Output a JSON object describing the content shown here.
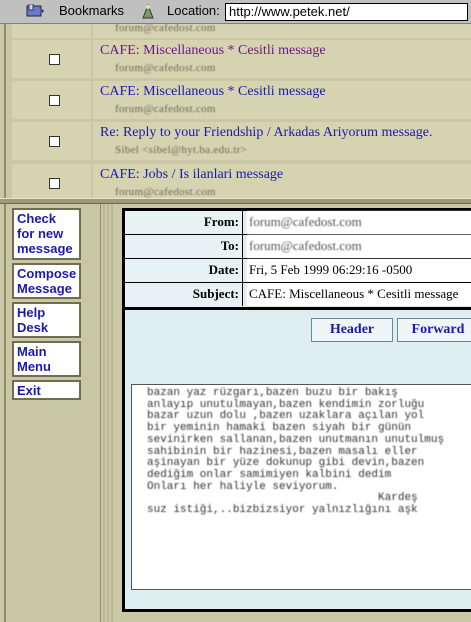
{
  "browser": {
    "bookmarks_label": "Bookmarks",
    "location_label": "Location:",
    "url": "http://www.petek.net/"
  },
  "message_list": [
    {
      "subject": "",
      "from": "forum@cafedost.com"
    },
    {
      "subject": "CAFE: Miscellaneous * Cesitli message",
      "from": "forum@cafedost.com"
    },
    {
      "subject": "CAFE: Miscellaneous * Cesitli message",
      "from": "forum@cafedost.com"
    },
    {
      "subject": "Re: Reply to your Friendship / Arkadas Ariyorum message.",
      "from": "Sibel <sibel@hyt.ba.edu.tr>"
    },
    {
      "subject": "CAFE: Jobs / Is ilanlari message",
      "from": "forum@cafedost.com"
    }
  ],
  "nav": {
    "check": "Check for new message",
    "compose": "Compose Message",
    "help": "Help Desk",
    "main": "Main Menu",
    "exit": "Exit"
  },
  "message": {
    "from_label": "From:",
    "from": "forum@cafedost.com",
    "to_label": "To:",
    "to": "forum@cafedost.com",
    "date_label": "Date:",
    "date": "Fri, 5 Feb 1999 06:29:16 -0500",
    "subject_label": "Subject:",
    "subject": "CAFE: Miscellaneous * Cesitli message",
    "header_button": "Header",
    "forward_button": "Forward",
    "body_lines": [
      "bazan yaz rüzgarı,bazen buzu bir bakış",
      "anlayıp unutulmayan,bazen kendimin zorluğu",
      "bazar uzun dolu ,bazen uzaklara açılan yol",
      "bir yeminin hamaki bazen siyah bir günün",
      "sevinirken sallanan,bazen unutmanın unutulmuş",
      "sahibinin bir hazinesi,bazen masalı eller",
      "aşinayan bir yüze dokunup gibi devin,bazen",
      "dediğim onlar samimiyen kalbini dedim",
      "",
      "Onları her haliyle seviyorum.",
      "                                   Kardeş",
      "suz istiği,..bizbizsiyor yalnızlığını aşk"
    ]
  },
  "colors": {
    "frame_bg": "#c9c7a6",
    "row_bg": "#d6d3b0",
    "link": "#1a1ab0",
    "visited_link": "#6a1a8a",
    "message_bg": "#dfeef0"
  }
}
